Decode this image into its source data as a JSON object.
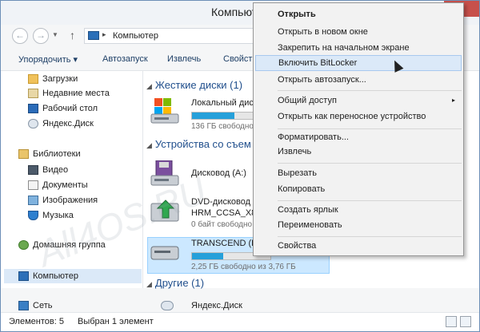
{
  "window": {
    "title": "Компьютер",
    "minimize": "–",
    "maximize": "□",
    "close": "×"
  },
  "nav": {
    "back": "←",
    "forward": "→",
    "up": "↑",
    "address_arrow": "▸",
    "address_path": "Компьютер"
  },
  "commands": [
    "Упорядочить ▾",
    "Автозапуск",
    "Извлечь",
    "Свойств"
  ],
  "sidebar": {
    "favorites": [
      {
        "label": "Загрузки",
        "icon": "downloads-icon"
      },
      {
        "label": "Недавние места",
        "icon": "recent-places-icon"
      },
      {
        "label": "Рабочий стол",
        "icon": "desktop-icon"
      },
      {
        "label": "Яндекс.Диск",
        "icon": "yandex-disk-icon"
      }
    ],
    "libraries_title": "Библиотеки",
    "libraries": [
      {
        "label": "Видео",
        "icon": "video-library-icon"
      },
      {
        "label": "Документы",
        "icon": "documents-library-icon"
      },
      {
        "label": "Изображения",
        "icon": "images-library-icon"
      },
      {
        "label": "Музыка",
        "icon": "music-library-icon"
      }
    ],
    "homegroup": "Домашняя группа",
    "computer": "Компьютер",
    "network": "Сеть"
  },
  "content": {
    "hard_disks_header": "Жесткие диски (1)",
    "local_disk_name": "Локальный дис",
    "local_disk_free": "136 ГБ свободно",
    "local_disk_fill": 0.68,
    "removable_header": "Устройства со съем",
    "floppy_name": "Дисковод (A:)",
    "dvd_name": "DVD-дисковод (",
    "dvd_label": "HRM_CCSA_X86",
    "dvd_free": "0 байт свободно",
    "usb_name": "TRANSCEND (E:)",
    "usb_free": "2,25 ГБ свободно из 3,76 ГБ",
    "usb_fill": 0.4,
    "other_header": "Другие (1)",
    "yandex_name": "Яндекс.Диск"
  },
  "context_menu": {
    "items": [
      {
        "label": "Открыть",
        "bold": true
      },
      {
        "label": "Открыть в новом окне"
      },
      {
        "label": "Закрепить на начальном экране"
      },
      {
        "label": "Включить BitLocker",
        "highlighted": true
      },
      {
        "label": "Открыть автозапуск..."
      },
      {
        "label": "Общий доступ",
        "submenu": "▸"
      },
      {
        "label": "Открыть как переносное устройство"
      },
      {
        "label": "Форматировать..."
      },
      {
        "label": "Извлечь"
      },
      {
        "label": "Вырезать"
      },
      {
        "label": "Копировать"
      },
      {
        "label": "Создать ярлык"
      },
      {
        "label": "Переименовать"
      },
      {
        "label": "Свойства"
      }
    ]
  },
  "status": {
    "items_count": "Элементов: 5",
    "selected": "Выбран 1 элемент"
  },
  "watermark": "All4OS.RU",
  "colors": {
    "accent": "#26a0da",
    "selection": "#cce8ff",
    "menu_highlight": "#dbe9f8",
    "header_text": "#1f4e8c"
  }
}
